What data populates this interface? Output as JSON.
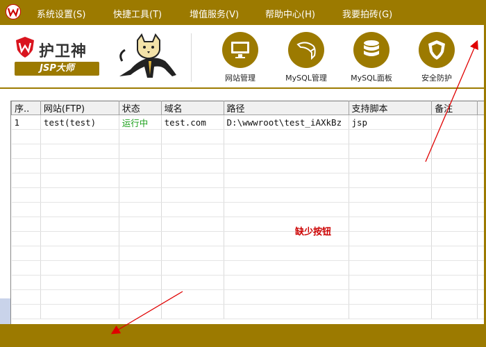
{
  "menubar": {
    "items": [
      {
        "label": "系统设置(S)"
      },
      {
        "label": "快捷工具(T)"
      },
      {
        "label": "增值服务(V)"
      },
      {
        "label": "帮助中心(H)"
      },
      {
        "label": "我要拍砖(G)"
      }
    ]
  },
  "brand": {
    "title": "护卫神",
    "subtitle": "JSP大师"
  },
  "toolbar": {
    "items": [
      {
        "label": "网站管理",
        "icon": "monitor-icon"
      },
      {
        "label": "MySQL管理",
        "icon": "dolphin-icon"
      },
      {
        "label": "MySQL面板",
        "icon": "database-icon"
      },
      {
        "label": "安全防护",
        "icon": "shield-icon"
      }
    ]
  },
  "grid": {
    "columns": [
      "序..",
      "网站(FTP)",
      "状态",
      "域名",
      "路径",
      "支持脚本",
      "备注"
    ],
    "rows": [
      [
        "1",
        "test(test)",
        "运行中",
        "test.com",
        "D:\\wwwroot\\test_iAXkBz",
        "jsp",
        ""
      ]
    ]
  },
  "annotation": {
    "text": "缺少按钮"
  },
  "colors": {
    "brand": "#9c7a00",
    "running": "#1aa01a",
    "annotation": "#cc0000"
  }
}
